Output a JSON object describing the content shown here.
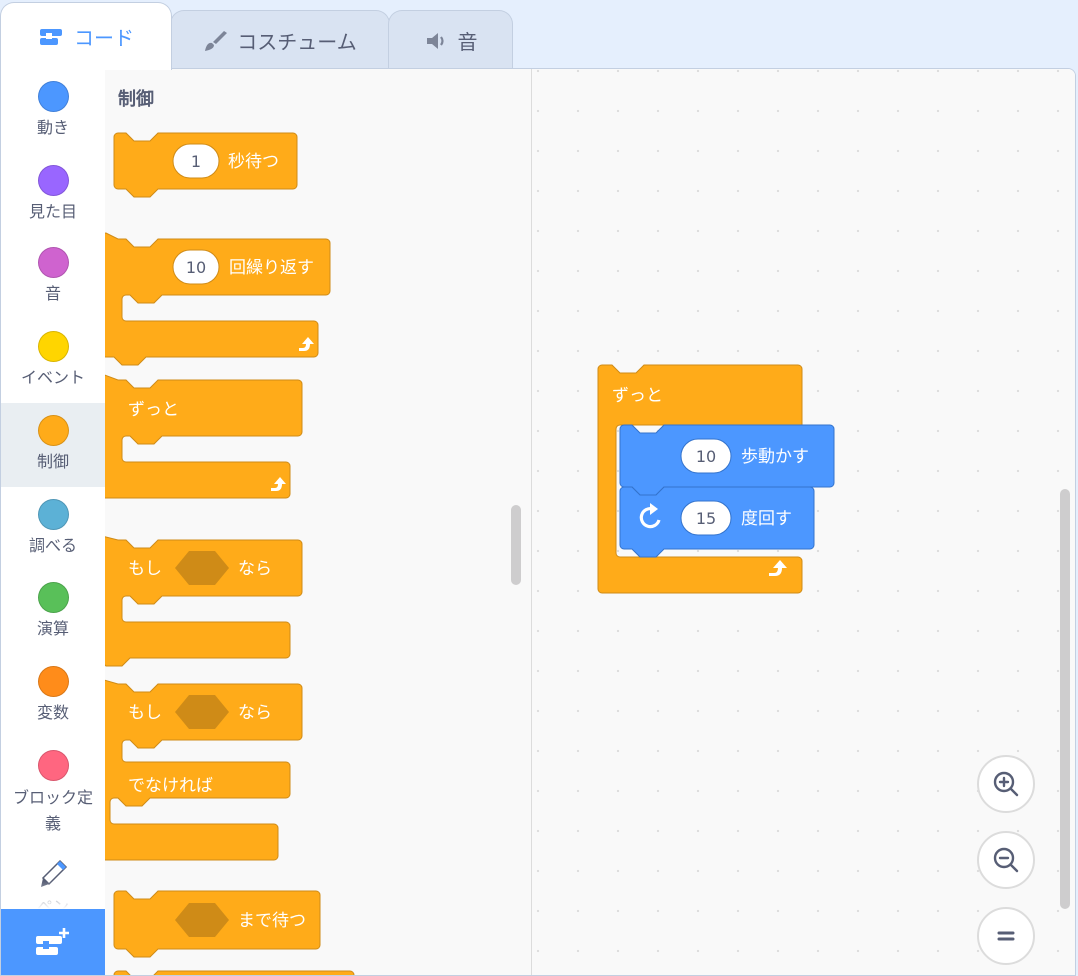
{
  "tabs": [
    {
      "label": "コード",
      "icon": "code-icon"
    },
    {
      "label": "コスチューム",
      "icon": "paintbrush-icon"
    },
    {
      "label": "音",
      "icon": "speaker-icon"
    }
  ],
  "categories": [
    {
      "label": "動き",
      "color": "#4c97ff"
    },
    {
      "label": "見た目",
      "color": "#9966ff"
    },
    {
      "label": "音",
      "color": "#cf63cf"
    },
    {
      "label": "イベント",
      "color": "#ffd500"
    },
    {
      "label": "制御",
      "color": "#ffab19",
      "selected": true
    },
    {
      "label": "調べる",
      "color": "#5cb1d6"
    },
    {
      "label": "演算",
      "color": "#59c059"
    },
    {
      "label": "変数",
      "color": "#ff8c1a"
    },
    {
      "label": "ブロック定義",
      "color": "#ff6680"
    },
    {
      "label": "ペン",
      "icon": "pen-icon"
    }
  ],
  "palette": {
    "title": "制御",
    "wait": {
      "value": "1",
      "label": "秒待つ"
    },
    "repeat": {
      "value": "10",
      "label": "回繰り返す"
    },
    "forever": {
      "label": "ずっと"
    },
    "if_then": {
      "if": "もし",
      "then": "なら"
    },
    "if_else": {
      "if": "もし",
      "then": "なら",
      "else": "でなければ"
    },
    "wait_until": {
      "label": "まで待つ"
    }
  },
  "script": {
    "forever": "ずっと",
    "move": {
      "value": "10",
      "label": "歩動かす"
    },
    "turn": {
      "value": "15",
      "label": "度回す"
    }
  },
  "colors": {
    "control": "#ffab19",
    "control_dark": "#cf8b17",
    "motion": "#4c97ff",
    "motion_dark": "#3373cc"
  }
}
